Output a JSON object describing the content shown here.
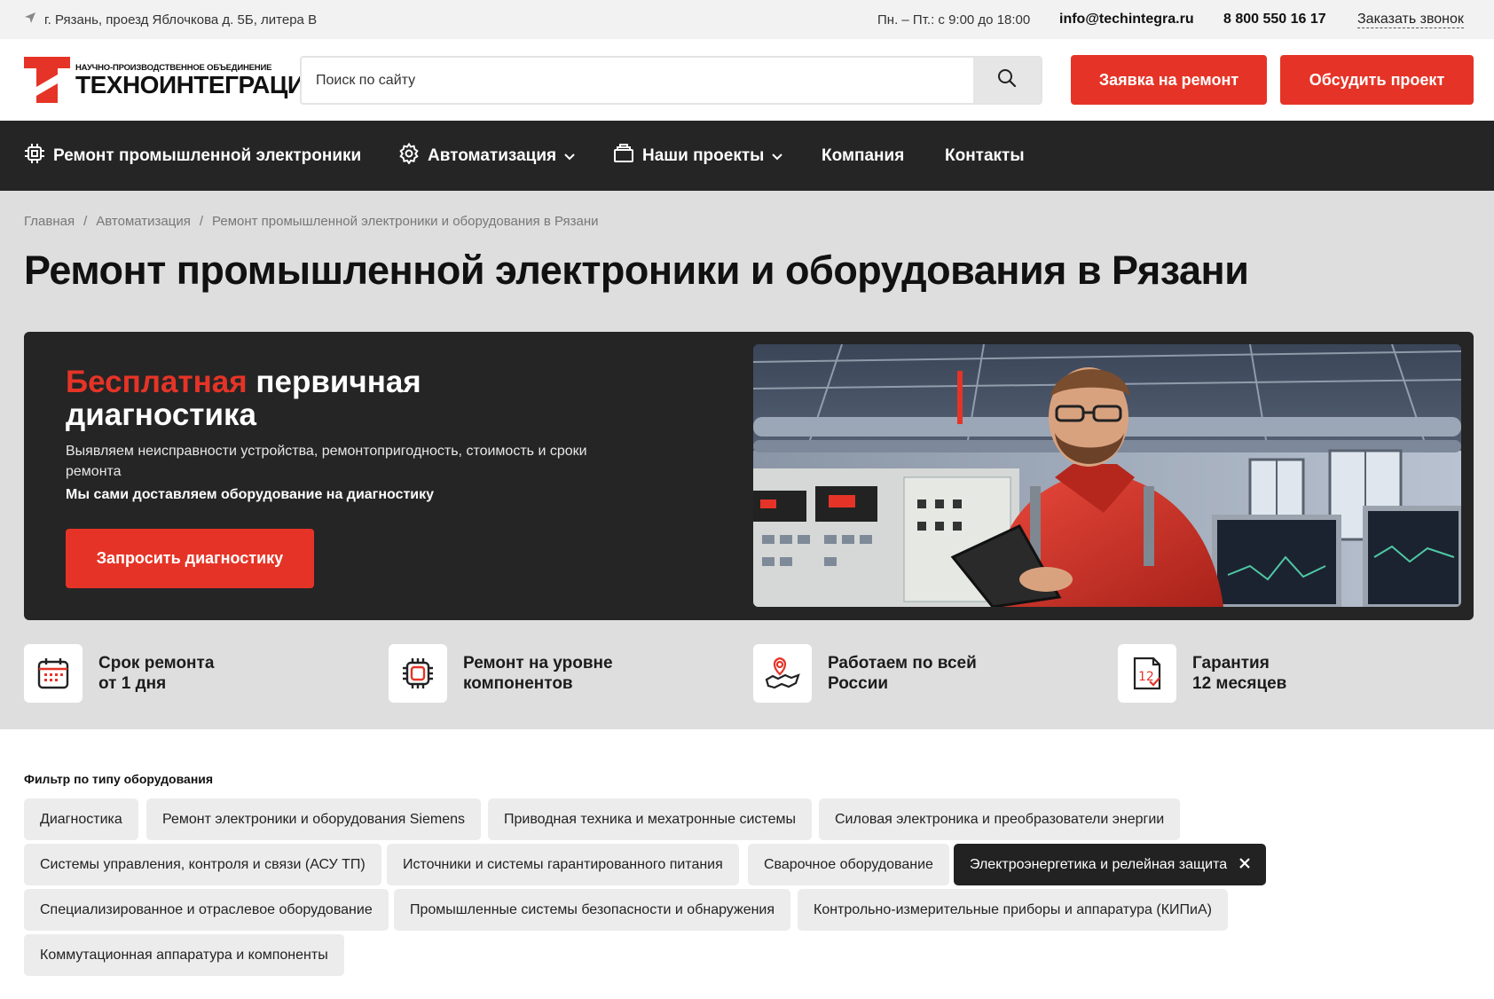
{
  "topbar": {
    "address": "г. Рязань, проезд Яблочкова д. 5Б, литера В",
    "hours": "Пн. – Пт.: с 9:00 до 18:00",
    "email": "info@techintegra.ru",
    "phone": "8 800 550 16 17",
    "callback": "Заказать звонок"
  },
  "header": {
    "logo_sub": "НАУЧНО-ПРОИЗВОДСТВЕННОЕ ОБЪЕДИНЕНИЕ",
    "logo_main": "ТЕХНОИНТЕГРАЦИЯ",
    "search_placeholder": "Поиск по сайту",
    "repair_button": "Заявка на ремонт",
    "discuss_button": "Обсудить проект"
  },
  "nav": {
    "items": [
      {
        "label": "Ремонт промышленной электроники",
        "icon": "chip-icon"
      },
      {
        "label": "Автоматизация",
        "icon": "gear-icon"
      },
      {
        "label": "Наши проекты",
        "icon": "projects-icon"
      },
      {
        "label": "Компания"
      },
      {
        "label": "Контакты"
      }
    ]
  },
  "breadcrumb": [
    "Главная",
    "Автоматизация",
    "Ремонт промышленной электроники и оборудования в Рязани"
  ],
  "page_title": "Ремонт промышленной электроники и оборудования в Рязани",
  "banner": {
    "title_accent": "Бесплатная",
    "title_rest": " первичная диагностика",
    "text": "Выявляем неисправности устройства, ремонтопригодность, стоимость и сроки ремонта",
    "bold_text": "Мы сами доставляем оборудование на диагностику",
    "button": "Запросить диагностику"
  },
  "features": [
    {
      "line1": "Срок ремонта",
      "line2": "от 1 дня",
      "icon": "calendar-icon"
    },
    {
      "line1": "Ремонт на уровне",
      "line2": "компонентов",
      "icon": "microchip-icon"
    },
    {
      "line1": "Работаем по всей",
      "line2": "России",
      "icon": "map-pin-icon"
    },
    {
      "line1": "Гарантия",
      "line2": "12 месяцев",
      "icon": "warranty-icon"
    }
  ],
  "filter": {
    "label": "Фильтр по типу оборудования",
    "chips": [
      "Диагностика",
      "Ремонт электроники и оборудования Siemens",
      "Приводная техника и мехатронные системы",
      "Силовая электроника и преобразователи энергии",
      "Системы управления, контроля и связи (АСУ ТП)",
      "Источники и системы гарантированного питания",
      "Сварочное оборудование",
      "Электроэнергетика и релейная защита",
      "Специализированное и отраслевое оборудование",
      "Промышленные системы безопасности и обнаружения",
      "Контрольно-измерительные приборы и аппаратура (КИПиА)",
      "Коммутационная аппаратура и компоненты"
    ],
    "active_chip": "Электроэнергетика и релейная защита"
  },
  "colors": {
    "accent": "#e53427",
    "dark": "#252525",
    "hero_bg": "#dedede"
  }
}
